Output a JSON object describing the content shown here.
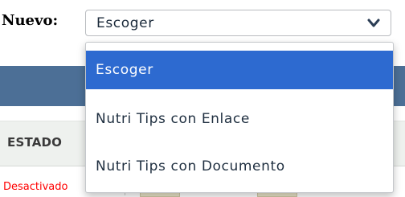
{
  "form": {
    "label": "Nuevo:",
    "select": {
      "selected": "Escoger",
      "icon": "chevron-down-icon",
      "options": [
        "Escoger",
        "Nutri Tips con Enlace",
        "Nutri Tips con Documento"
      ]
    }
  },
  "table": {
    "header": {
      "estado": "ESTADO"
    },
    "row": {
      "status": "Desactivado"
    }
  },
  "colors": {
    "highlight": "#2d6ad0",
    "band": "#4c6f96",
    "inactive": "#ff0000"
  }
}
